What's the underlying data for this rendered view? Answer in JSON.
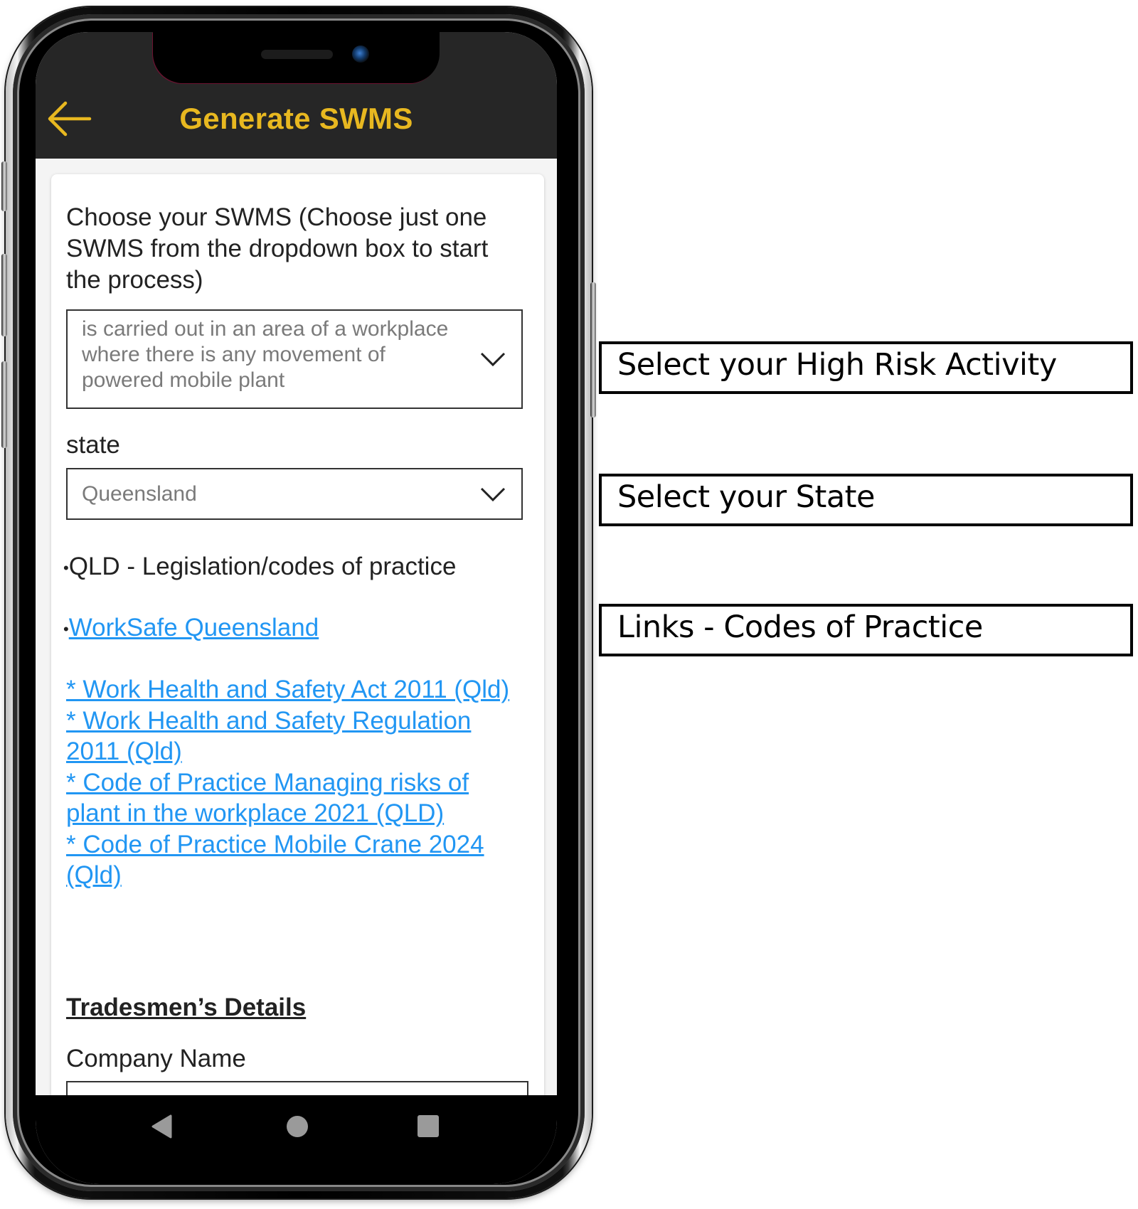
{
  "header": {
    "title": "Generate SWMS",
    "back_icon": "arrow-left-icon",
    "accent_color": "#e8b820",
    "background_color": "#262626"
  },
  "form": {
    "swms_label": "Choose your SWMS (Choose just one SWMS from the dropdown box to start the process)",
    "swms_select": {
      "value": "is carried out in an area of a workplace where there is any movement of powered mobile plant",
      "icon": "chevron-down-icon"
    },
    "state_label": "state",
    "state_select": {
      "value": "Queensland",
      "icon": "chevron-down-icon"
    },
    "legislation_heading": "QLD - Legislation/codes of practice",
    "bullet": "•",
    "worksafe_link": "WorkSafe Queensland",
    "links": [
      "* Work Health and Safety Act 2011 (Qld) ",
      "* Work Health and Safety Regulation 2011 (Qld)",
      "* Code of Practice Managing risks of plant in the workplace 2021 (QLD)",
      "* Code of Practice Mobile Crane 2024 (Qld)"
    ],
    "link_color": "#2196f3",
    "tradesmen_heading": "Tradesmen’s Details",
    "company_name_label": "Company Name",
    "company_name_value": ""
  },
  "navbar": {
    "back": "nav-back-icon",
    "home": "nav-home-icon",
    "recents": "nav-recents-icon"
  },
  "callouts": [
    "Select your High Risk Activity",
    "Select your State",
    "Links - Codes of Practice"
  ]
}
